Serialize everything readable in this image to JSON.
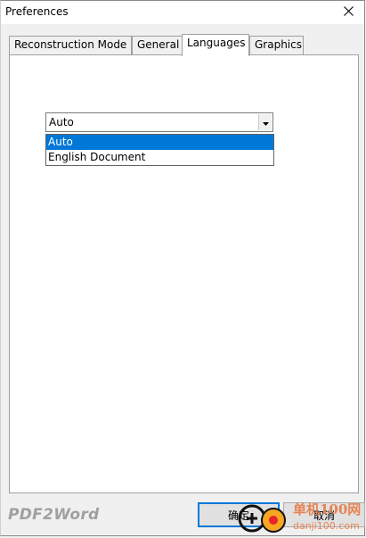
{
  "window": {
    "title": "Preferences",
    "close_symbol": "✕"
  },
  "tabs": [
    {
      "label": "Reconstruction Mode",
      "active": false
    },
    {
      "label": "General",
      "active": false
    },
    {
      "label": "Languages",
      "active": true
    },
    {
      "label": "Graphics",
      "active": false
    }
  ],
  "languages": {
    "selected": "Auto",
    "options": [
      "Auto",
      "English Document"
    ]
  },
  "footer": {
    "brand": "PDF2Word",
    "ok_label": "确定",
    "cancel_label": "取消"
  },
  "watermark": {
    "site_name": "单机100网",
    "site_url": "danji100.com"
  },
  "colors": {
    "selection": "#0078d7",
    "watermark": "#e8743b"
  }
}
